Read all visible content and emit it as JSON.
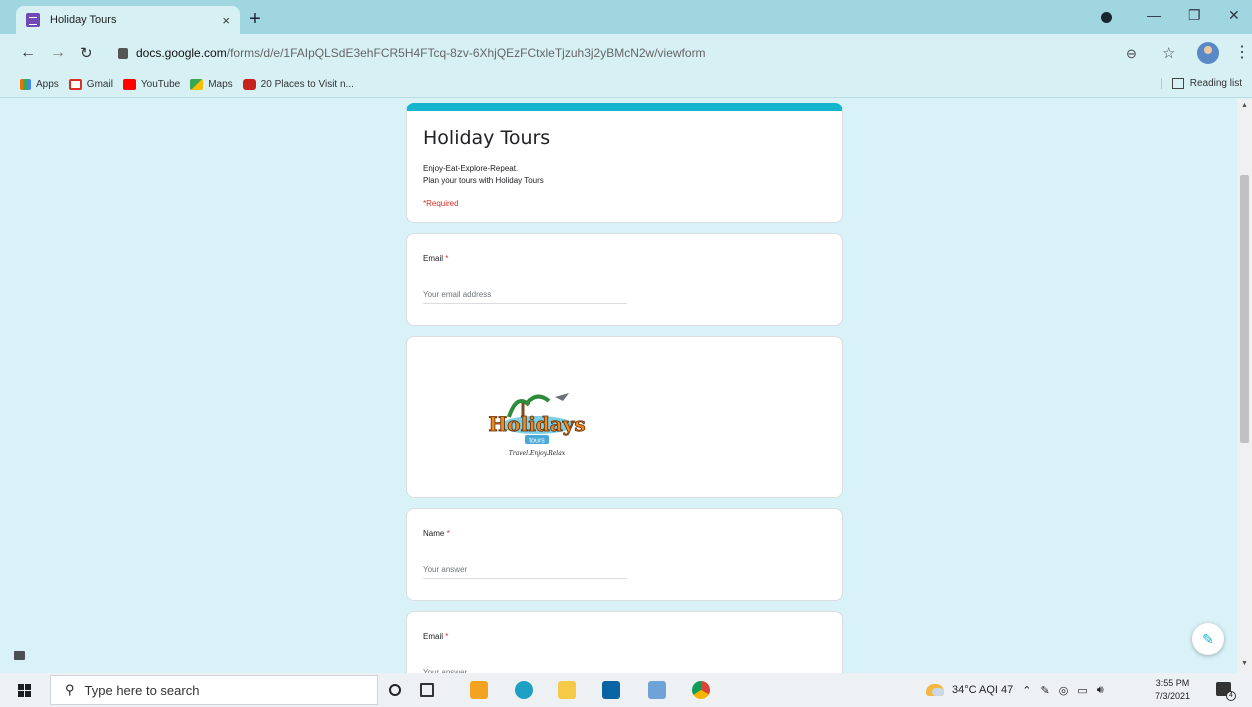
{
  "browser": {
    "tab_title": "Holiday Tours",
    "tab_close": "×",
    "new_tab": "+",
    "url_host": "docs.google.com",
    "url_path": "/forms/d/e/1FAIpQLSdE3ehFCR5H4FTcq-8zv-6XhjQEzFCtxleTjzuh3j2yBMcN2w/viewform",
    "bookmarks": [
      {
        "label": "Apps",
        "icon": "apps-grid-icon",
        "color": "#e8710a"
      },
      {
        "label": "Gmail",
        "icon": "gmail-icon",
        "color": "#d93025"
      },
      {
        "label": "YouTube",
        "icon": "youtube-icon",
        "color": "#ff0000"
      },
      {
        "label": "Maps",
        "icon": "maps-icon",
        "color": "#34a853"
      },
      {
        "label": "20 Places to Visit n...",
        "icon": "bookmark-site-icon",
        "color": "#c5221f"
      }
    ],
    "reading_list": "Reading list"
  },
  "form": {
    "accent": "#12b5cb",
    "title": "Holiday Tours",
    "description": "Enjoy-Eat-Explore-Repeat.\nPlan your tours with Holiday Tours",
    "required_note": "*Required",
    "questions": [
      {
        "label": "Email",
        "required_mark": " *",
        "placeholder": "Your email address"
      },
      {
        "label": "Name",
        "required_mark": " *",
        "placeholder": "Your answer"
      },
      {
        "label": "Email",
        "required_mark": " *",
        "placeholder": "Your answer"
      }
    ],
    "logo": {
      "main": "Holidays",
      "sub": "tours",
      "tagline": "Travel.Enjoy.Relax"
    }
  },
  "taskbar": {
    "search_placeholder": "Type here to search",
    "weather": "34°C  AQI 47",
    "time": "3:55 PM",
    "date": "7/3/2021",
    "notification_count": "4"
  }
}
